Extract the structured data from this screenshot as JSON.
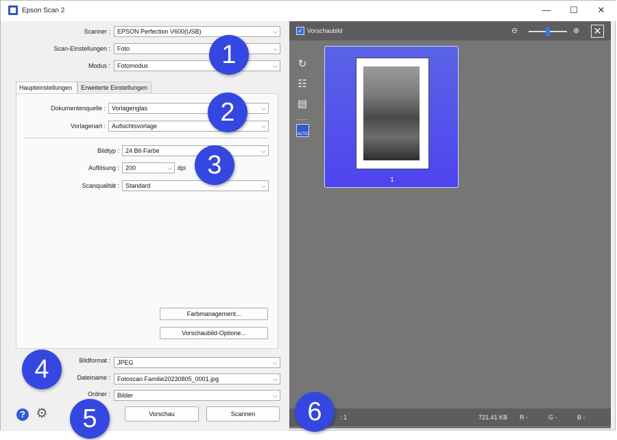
{
  "window": {
    "title": "Epson Scan 2",
    "controls": {
      "minimize": "—",
      "maximize": "☐",
      "close": "✕"
    }
  },
  "scanner_section": {
    "scanner_label": "Scanner :",
    "scanner_value": "EPSON Perfection V600(USB)",
    "scan_settings_label": "Scan-Einstellungen :",
    "scan_settings_value": "Foto",
    "mode_label": "Modus :",
    "mode_value": "Fotomodus"
  },
  "tabs": {
    "main": "Haupteinstellungen",
    "advanced": "Erweiterte Einstellungen"
  },
  "main_settings": {
    "doc_source_label": "Dokumentenquelle :",
    "doc_source_value": "Vorlagenglas",
    "doc_type_label": "Vorlagenart :",
    "doc_type_value": "Aufsichtsvorlage",
    "image_type_label": "Bildtyp :",
    "image_type_value": "24 Bit-Farbe",
    "resolution_label": "Auflösung :",
    "resolution_value": "200",
    "resolution_unit": "dpi",
    "scan_quality_label": "Scanqualität :",
    "scan_quality_value": "Standard",
    "color_mgmt_button": "Farbmanagement...",
    "preview_options_button": "Vorschaubild-Optione..."
  },
  "output": {
    "format_label": "Bildformat :",
    "format_value": "JPEG",
    "filename_label": "Dateiname :",
    "filename_value": "Fotoscan Familie20230805_0001.jpg",
    "folder_label": "Ordner :",
    "folder_value": "Bilder"
  },
  "bottom_buttons": {
    "preview": "Vorschau",
    "scan": "Scannen"
  },
  "preview_panel": {
    "thumbnail_checkbox_label": "Vorschaubild",
    "zoom_out": "⊖",
    "zoom_in": "⊕",
    "close": "✕",
    "thumbnail_number": "1",
    "auto_label": "AUTO",
    "status_count": ": 1",
    "status_size": "721.41 KB",
    "status_r": "R  -",
    "status_g": "G  -",
    "status_b": "B  -"
  },
  "callouts": [
    "1",
    "2",
    "3",
    "4",
    "5",
    "6"
  ],
  "colors": {
    "accent": "#3447e0",
    "thumbnail_bg": "#5158ea",
    "preview_bg": "#767676"
  }
}
